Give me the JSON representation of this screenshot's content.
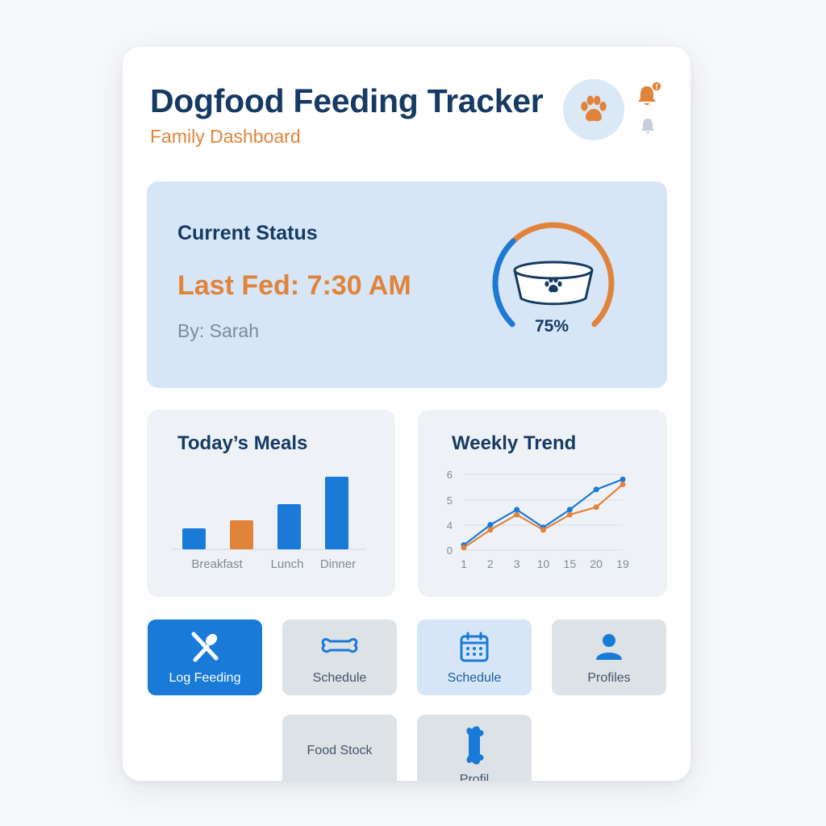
{
  "header": {
    "title": "Dogfood Feeding Tracker",
    "subtitle": "Family Dashboard",
    "notification_badge": "!"
  },
  "status": {
    "heading": "Current Status",
    "last_fed": "Last Fed: 7:30 AM",
    "by": "By: Sarah",
    "bowl_level": 0.75,
    "bowl_level_label": "75%"
  },
  "meals_panel": {
    "title": "Today’s Meals"
  },
  "trend_panel": {
    "title": "Weekly Trend"
  },
  "chart_data": [
    {
      "type": "bar",
      "title": "Today’s Meals",
      "categories": [
        "Breakfast",
        "",
        "Lunch",
        "Dinner"
      ],
      "values": [
        1.3,
        1.8,
        2.8,
        4.5
      ],
      "bar_colors": [
        "#1a7ad8",
        "#e0833b",
        "#1a7ad8",
        "#1a7ad8"
      ],
      "ylim": [
        0,
        5
      ]
    },
    {
      "type": "line",
      "title": "Weekly Trend",
      "x": [
        "1",
        "2",
        "3",
        "10",
        "15",
        "20",
        "19"
      ],
      "y_ticks": [
        "0",
        "4",
        "5",
        "6"
      ],
      "grid": true,
      "series": [
        {
          "values": [
            0.2,
            1.0,
            1.6,
            0.9,
            1.6,
            2.4,
            2.8
          ],
          "color": "#1a7ad8"
        },
        {
          "values": [
            0.1,
            0.8,
            1.4,
            0.8,
            1.4,
            1.7,
            2.6
          ],
          "color": "#e0833b"
        }
      ],
      "ylim": [
        0,
        3
      ]
    }
  ],
  "actions": [
    {
      "label": "Log Feeding",
      "icon": "utensils-icon"
    },
    {
      "label": "Schedule",
      "icon": "bone-icon"
    },
    {
      "label": "Schedule",
      "icon": "calendar-icon"
    },
    {
      "label": "Profiles",
      "icon": "person-icon"
    },
    {
      "label": "Food Stock",
      "icon": ""
    },
    {
      "label": "Profil",
      "icon": "bone-icon"
    }
  ],
  "colors": {
    "brand_blue": "#1a7ad8",
    "brand_orange": "#e0833b",
    "title_navy": "#163a63"
  }
}
